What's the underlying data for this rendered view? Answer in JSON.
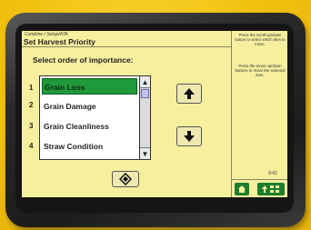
{
  "screen": {
    "breadcrumb": "Combine / Setup/ATA",
    "title": "Set Harvest Priority",
    "prompt": "Select order of importance:",
    "rank_numbers": [
      "1",
      "2",
      "3",
      "4"
    ],
    "priority_list": [
      {
        "label": "Grain Loss",
        "selected": true
      },
      {
        "label": "Grain Damage",
        "selected": false
      },
      {
        "label": "Grain Cleanliness",
        "selected": false
      },
      {
        "label": "Straw Condition",
        "selected": false
      }
    ],
    "help_select": "Press the scroll up/down button to select which item to move.",
    "help_move": "Press the move up/down buttons to move the selected item.",
    "time": "9:42"
  },
  "colors": {
    "background": "#f3c412",
    "screen": "#f6ef9e",
    "selection": "#1f9a3a",
    "softkey": "#1c7d2f"
  },
  "icons": {
    "move_up": "arrow-up-icon",
    "move_down": "arrow-down-icon",
    "bottom_button": "enter-diamond-icon",
    "softkey_1": "home-icon",
    "softkey_2": "menu-grid-icon"
  }
}
